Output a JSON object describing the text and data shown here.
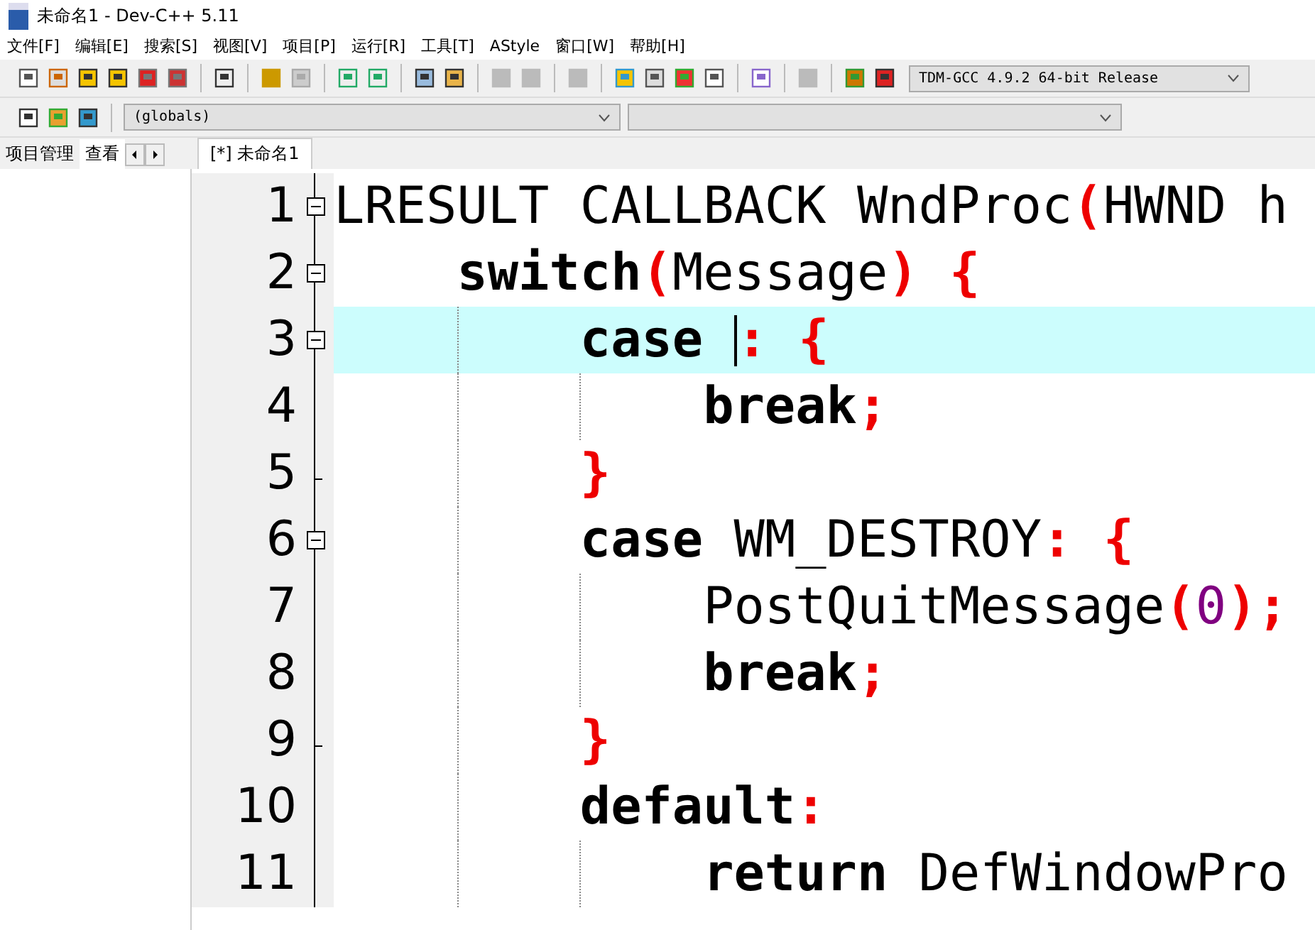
{
  "window": {
    "title": "未命名1 - Dev-C++ 5.11"
  },
  "menu": [
    "文件[F]",
    "编辑[E]",
    "搜索[S]",
    "视图[V]",
    "项目[P]",
    "运行[R]",
    "工具[T]",
    "AStyle",
    "窗口[W]",
    "帮助[H]"
  ],
  "compiler_select": {
    "value": "TDM-GCC 4.9.2 64-bit Release"
  },
  "scope_select": {
    "value": "(globals)"
  },
  "side_tabs": [
    {
      "label": "项目管理",
      "selected": false
    },
    {
      "label": "查看",
      "selected": true
    }
  ],
  "editor_tabs": [
    {
      "label": "[*] 未命名1",
      "selected": true
    }
  ],
  "lines": [
    {
      "number": "1",
      "kind": "fold_start",
      "expanded": true,
      "current": false,
      "tokens": [
        {
          "kind": "id",
          "text": "LRESULT CALLBACK WndProc"
        },
        {
          "kind": "op",
          "text": "("
        },
        {
          "kind": "id",
          "text": "HWND h"
        }
      ]
    },
    {
      "number": "2",
      "kind": "fold_start",
      "expanded": true,
      "current": false,
      "tokens": [
        {
          "kind": "kw",
          "text": "    switch"
        },
        {
          "kind": "op",
          "text": "("
        },
        {
          "kind": "id",
          "text": "Message"
        },
        {
          "kind": "op",
          "text": ") {"
        }
      ]
    },
    {
      "number": "3",
      "kind": "fold_start",
      "expanded": true,
      "current": true,
      "tokens": [
        {
          "kind": "kw",
          "text": "        case "
        },
        {
          "kind": "caret"
        },
        {
          "kind": "op",
          "text": ": {"
        }
      ]
    },
    {
      "number": "4",
      "kind": "plain",
      "current": false,
      "tokens": [
        {
          "kind": "kw",
          "text": "            break"
        },
        {
          "kind": "op",
          "text": ";"
        }
      ]
    },
    {
      "number": "5",
      "kind": "fold_end",
      "current": false,
      "tokens": [
        {
          "kind": "op",
          "text": "        }"
        }
      ]
    },
    {
      "number": "6",
      "kind": "fold_start",
      "expanded": true,
      "current": false,
      "tokens": [
        {
          "kind": "kw",
          "text": "        case"
        },
        {
          "kind": "id",
          "text": " WM_DESTROY"
        },
        {
          "kind": "op",
          "text": ": {"
        }
      ]
    },
    {
      "number": "7",
      "kind": "plain",
      "current": false,
      "tokens": [
        {
          "kind": "id",
          "text": "            PostQuitMessage"
        },
        {
          "kind": "op",
          "text": "("
        },
        {
          "kind": "num",
          "text": "0"
        },
        {
          "kind": "op",
          "text": ");"
        }
      ]
    },
    {
      "number": "8",
      "kind": "plain",
      "current": false,
      "tokens": [
        {
          "kind": "kw",
          "text": "            break"
        },
        {
          "kind": "op",
          "text": ";"
        }
      ]
    },
    {
      "number": "9",
      "kind": "fold_end",
      "current": false,
      "tokens": [
        {
          "kind": "op",
          "text": "        }"
        }
      ]
    },
    {
      "number": "10",
      "kind": "plain",
      "current": false,
      "tokens": [
        {
          "kind": "kw",
          "text": "        default"
        },
        {
          "kind": "op",
          "text": ":"
        }
      ]
    },
    {
      "number": "11",
      "kind": "plain",
      "current": false,
      "tokens": [
        {
          "kind": "kw",
          "text": "            return"
        },
        {
          "kind": "id",
          "text": " DefWindowPro"
        }
      ]
    }
  ]
}
